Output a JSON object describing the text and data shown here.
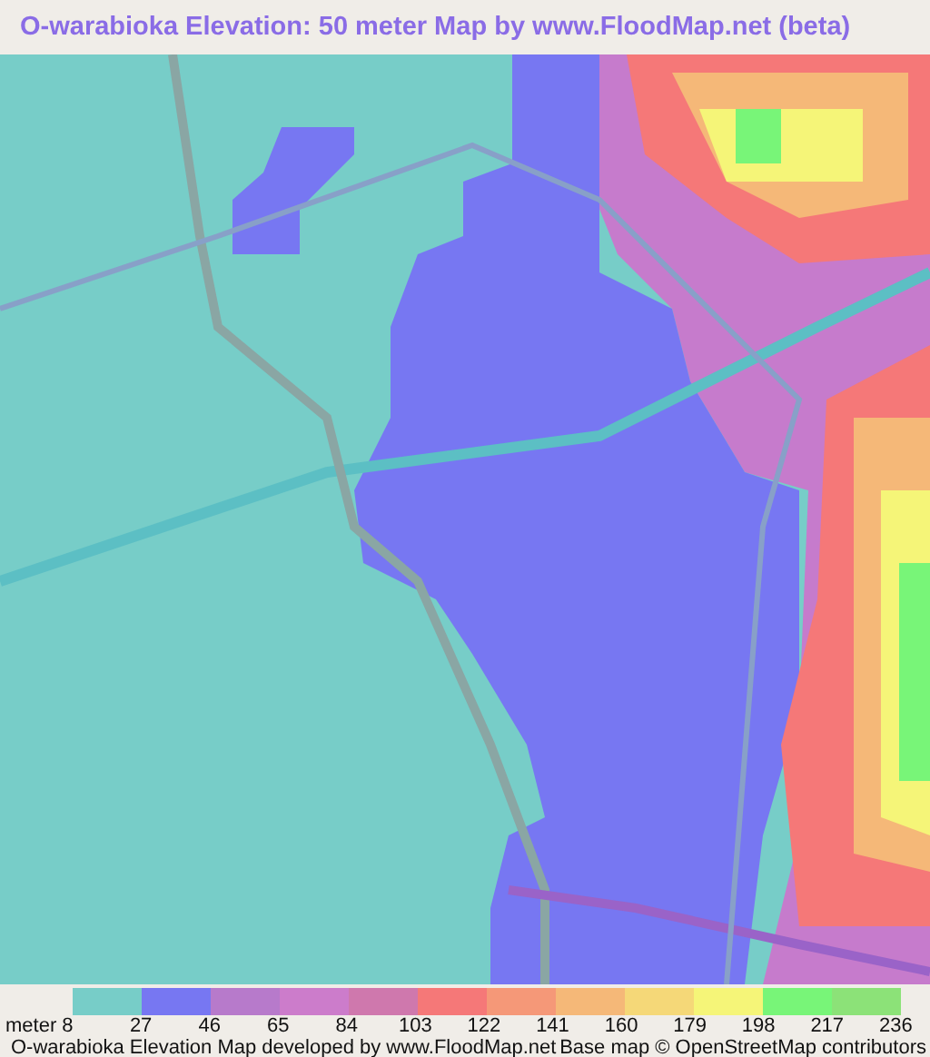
{
  "title": "O-warabioka Elevation: 50 meter Map by www.FloodMap.net (beta)",
  "legend": {
    "unit": "meter",
    "swatches": [
      {
        "color": "#77cdc8"
      },
      {
        "color": "#7777f2"
      },
      {
        "color": "#b77acb"
      },
      {
        "color": "#cc7ccb"
      },
      {
        "color": "#cf78ad"
      },
      {
        "color": "#f57878"
      },
      {
        "color": "#f59878"
      },
      {
        "color": "#f5b878"
      },
      {
        "color": "#f5d878"
      },
      {
        "color": "#f5f578"
      },
      {
        "color": "#78f578"
      },
      {
        "color": "#8ce278"
      }
    ],
    "ticks": [
      "8",
      "27",
      "46",
      "65",
      "84",
      "103",
      "122",
      "141",
      "160",
      "179",
      "198",
      "217",
      "236"
    ]
  },
  "footer": {
    "left": "O-warabioka Elevation Map developed by www.FloodMap.net",
    "right": "Base map © OpenStreetMap contributors"
  }
}
